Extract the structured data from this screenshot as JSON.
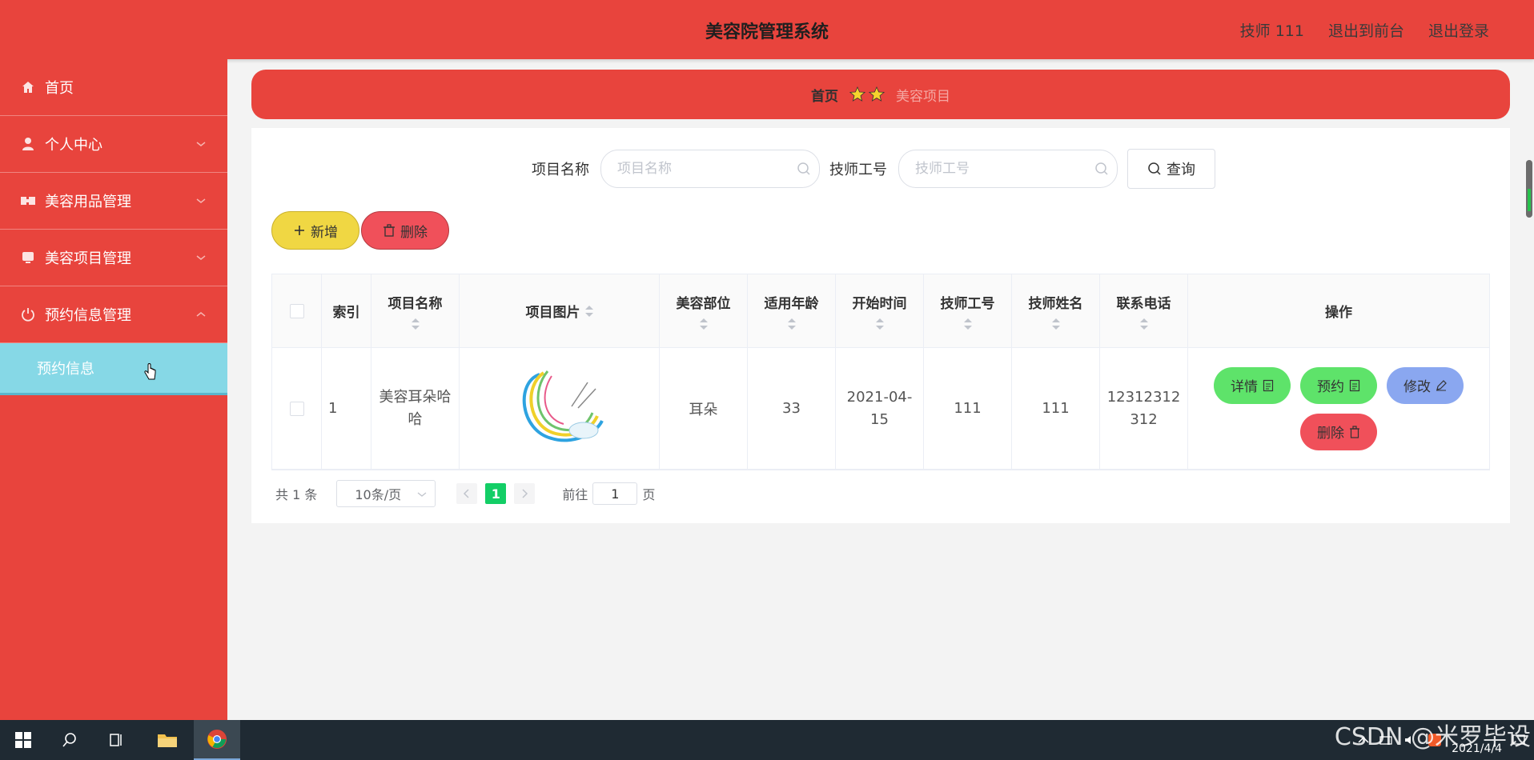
{
  "header": {
    "title": "美容院管理系统",
    "user_label": "技师 111",
    "front_link": "退出到前台",
    "logout_link": "退出登录"
  },
  "sidebar": {
    "items": [
      {
        "label": "首页",
        "icon": "home-icon"
      },
      {
        "label": "个人中心",
        "icon": "user-icon"
      },
      {
        "label": "美容用品管理",
        "icon": "product-icon"
      },
      {
        "label": "美容项目管理",
        "icon": "project-icon"
      },
      {
        "label": "预约信息管理",
        "icon": "power-icon"
      }
    ],
    "subitem": "预约信息"
  },
  "breadcrumb": {
    "home": "首页",
    "current": "美容项目"
  },
  "search": {
    "name_label": "项目名称",
    "name_placeholder": "项目名称",
    "tech_label": "技师工号",
    "tech_placeholder": "技师工号",
    "query_label": "查询"
  },
  "actions": {
    "add_label": "新增",
    "delete_label": "删除"
  },
  "table": {
    "headers": {
      "index": "索引",
      "name": "项目名称",
      "image": "项目图片",
      "part": "美容部位",
      "age": "适用年龄",
      "start": "开始时间",
      "tech_no": "技师工号",
      "tech_name": "技师姓名",
      "phone": "联系电话",
      "ops": "操作"
    },
    "rows": [
      {
        "index": "1",
        "name": "美容耳朵哈哈",
        "part": "耳朵",
        "age": "33",
        "start": "2021-04-15",
        "tech_no": "111",
        "tech_name": "111",
        "phone": "12312312312"
      }
    ],
    "op_labels": {
      "detail": "详情",
      "book": "预约",
      "edit": "修改",
      "delete": "删除"
    }
  },
  "pagination": {
    "total": "共 1 条",
    "page_size": "10条/页",
    "current_page": "1",
    "goto_label": "前往",
    "goto_value": "1",
    "page_suffix": "页"
  },
  "taskbar": {
    "date": "2021/4/4",
    "watermark": "CSDN @米罗毕设"
  },
  "colors": {
    "brand_red": "#e8443d",
    "submenu_cyan": "#86d8e6",
    "add_yellow": "#f0d743",
    "delete_red": "#f0505a",
    "detail_green": "#5ee36a",
    "edit_blue": "#8aa7f0",
    "page_active": "#13ce66"
  }
}
